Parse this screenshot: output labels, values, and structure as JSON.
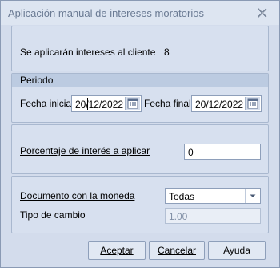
{
  "window": {
    "title": "Aplicación manual de intereses moratorios"
  },
  "info": {
    "label": "Se aplicarán intereses al cliente",
    "value": "8"
  },
  "periodo": {
    "header": "Periodo",
    "fecha_inicial_label": "Fecha inicial",
    "fecha_inicial": "20/12/2022",
    "fecha_final_label": "Fecha final",
    "fecha_final": "20/12/2022"
  },
  "porcentaje": {
    "label": "Porcentaje de interés a aplicar",
    "value": "0"
  },
  "moneda": {
    "documento_label": "Documento con la moneda",
    "documento_value": "Todas",
    "tipo_cambio_label": "Tipo de cambio",
    "tipo_cambio_value": "1.00"
  },
  "buttons": {
    "aceptar": "Aceptar",
    "cancelar": "Cancelar",
    "ayuda": "Ayuda"
  }
}
